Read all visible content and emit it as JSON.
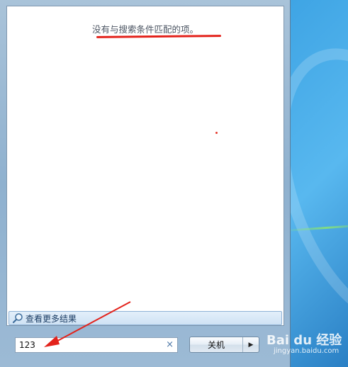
{
  "results": {
    "empty_message": "没有与搜索条件匹配的项。"
  },
  "see_more": {
    "label": "查看更多结果"
  },
  "search": {
    "value": "123",
    "clear_glyph": "×"
  },
  "shutdown": {
    "label": "关机",
    "arrow_glyph": "▶"
  },
  "annotation": {
    "color": "#e3221b"
  },
  "watermark": {
    "logo_text": "Bai du 经验",
    "sub_text": "jingyan.baidu.com"
  },
  "icons": [
    "magnifier-icon",
    "clear-icon",
    "arrow-right-icon"
  ]
}
